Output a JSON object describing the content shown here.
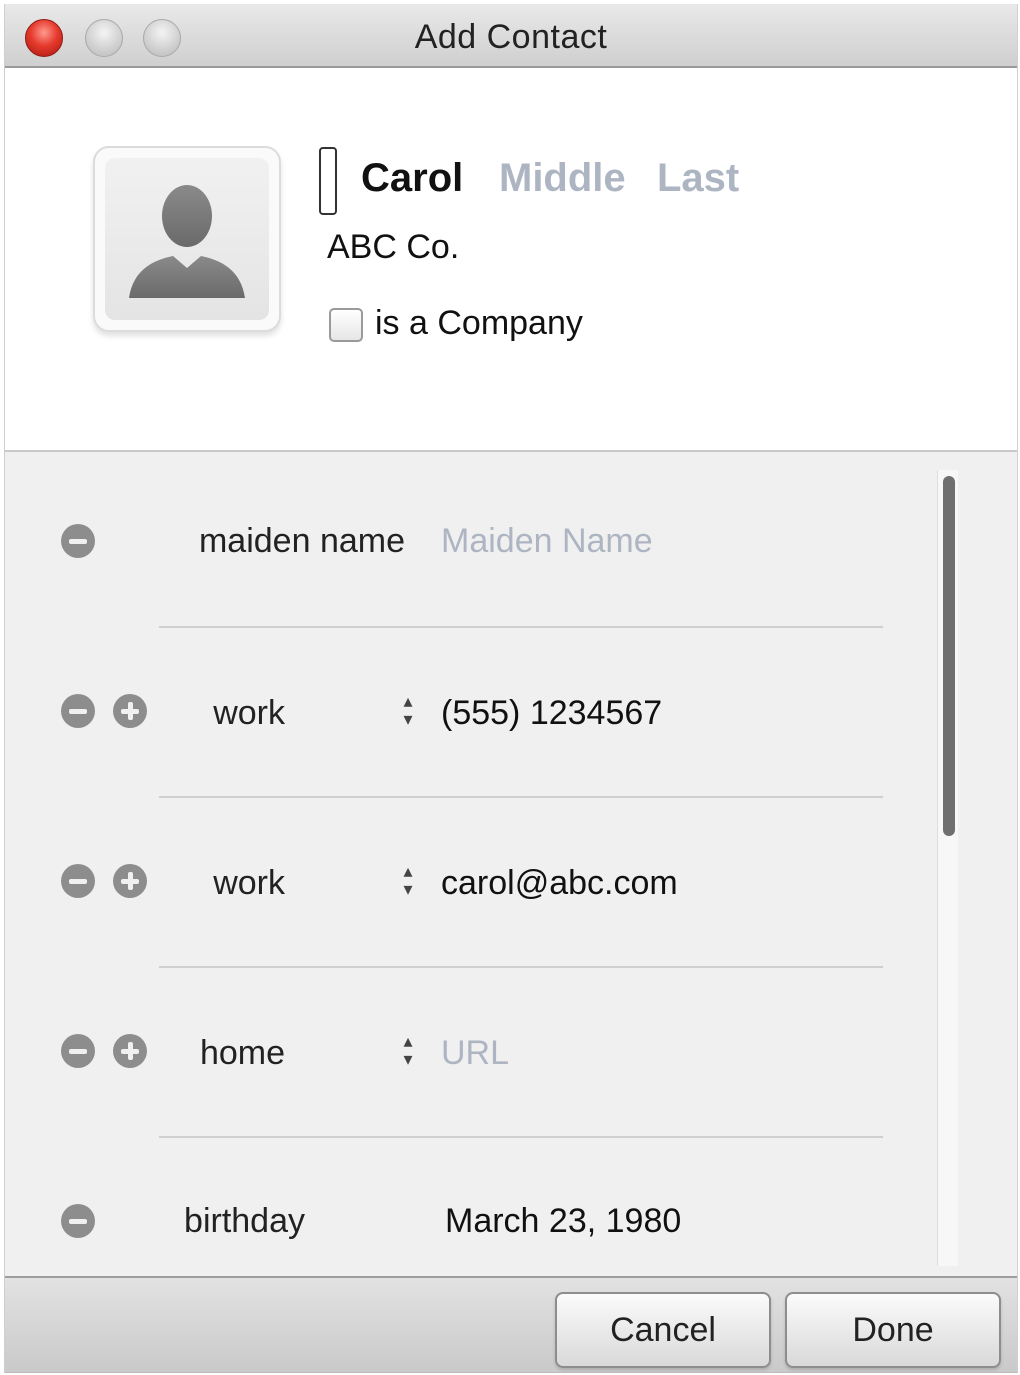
{
  "window": {
    "title": "Add Contact"
  },
  "card": {
    "first_name": "Carol",
    "middle_placeholder": "Middle",
    "last_placeholder": "Last",
    "company": "ABC Co.",
    "is_company_label": "is a Company",
    "is_company_checked": false
  },
  "fields": [
    {
      "label": "maiden name",
      "value": "Maiden Name",
      "is_placeholder": true,
      "has_add": false,
      "has_stepper": false
    },
    {
      "label": "work",
      "value": "(555) 1234567",
      "is_placeholder": false,
      "has_add": true,
      "has_stepper": true
    },
    {
      "label": "work",
      "value": "carol@abc.com",
      "is_placeholder": false,
      "has_add": true,
      "has_stepper": true
    },
    {
      "label": "home",
      "value": "URL",
      "is_placeholder": true,
      "has_add": true,
      "has_stepper": true
    },
    {
      "label": "birthday",
      "value": "March 23, 1980",
      "is_placeholder": false,
      "has_add": false,
      "has_stepper": false
    }
  ],
  "footer": {
    "cancel_label": "Cancel",
    "done_label": "Done"
  },
  "colors": {
    "close_button": "#e63b2e",
    "placeholder_text": "#aeb5c2"
  }
}
